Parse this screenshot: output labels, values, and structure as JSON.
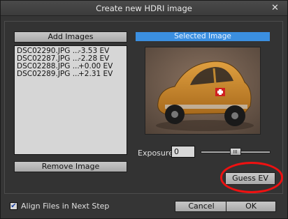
{
  "window": {
    "title": "Create new HDRI image",
    "close_glyph": "✕"
  },
  "left_panel": {
    "add_images_label": "Add Images",
    "remove_image_label": "Remove Image",
    "files": [
      {
        "name": "DSC02290.JPG ...",
        "ev": "-3.53 EV"
      },
      {
        "name": "DSC02287.JPG ...",
        "ev": "-2.28 EV"
      },
      {
        "name": "DSC02288.JPG ...",
        "ev": "+0.00 EV"
      },
      {
        "name": "DSC02289.JPG ...",
        "ev": "+2.31 EV"
      }
    ]
  },
  "right_panel": {
    "selected_label": "Selected Image",
    "exposure_label": "Exposure",
    "exposure_value": "0",
    "exposure_slider_fraction": 0.5,
    "guess_ev_label": "Guess EV",
    "highlight_color": "#ee1111",
    "accent_color": "#3b8fe0"
  },
  "footer": {
    "align_label": "Align Files in Next Step",
    "align_checked": true,
    "check_glyph": "✔",
    "cancel_label": "Cancel",
    "ok_label": "OK"
  }
}
